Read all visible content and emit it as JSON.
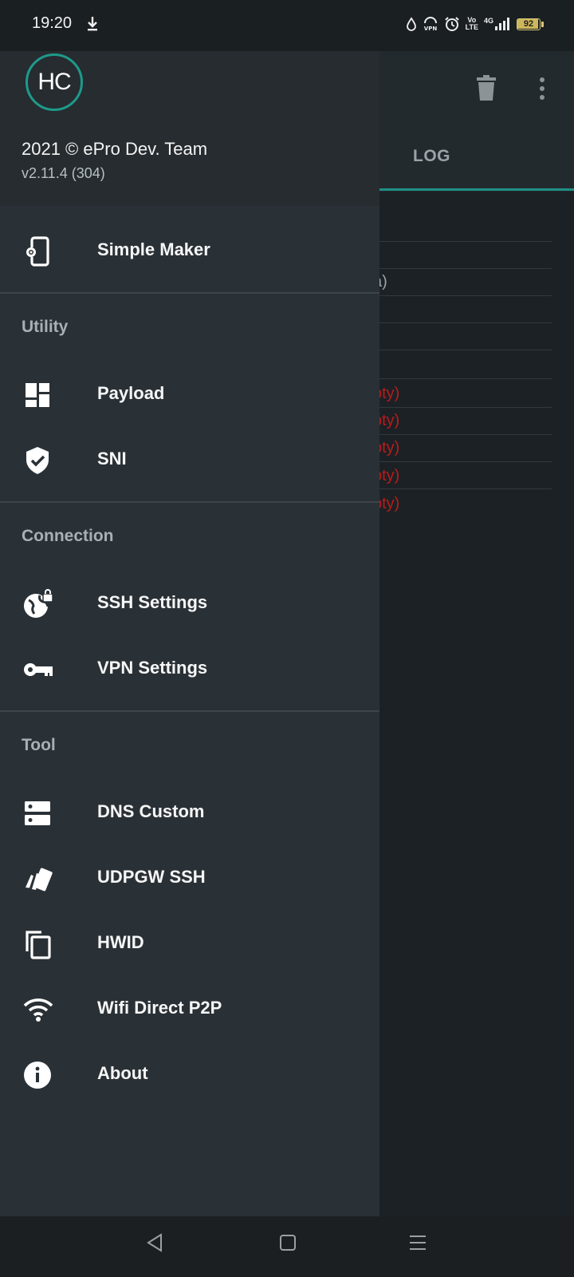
{
  "status_bar": {
    "time": "19:20",
    "battery": "92",
    "lte_label": "LTE",
    "vo_label": "Vo",
    "network": "4G",
    "icons": [
      "download-icon",
      "water-drop-icon",
      "vpn-icon",
      "alarm-icon",
      "volte-icon",
      "signal-icon",
      "battery-icon"
    ]
  },
  "background_app": {
    "tab_log": "LOG",
    "partial_gray": [
      "a)"
    ],
    "partial_red": [
      "pty)",
      "pty)",
      "pty)",
      "pty)",
      "pty)"
    ]
  },
  "drawer": {
    "logo_text": "HC",
    "copyright": "2021 © ePro Dev. Team",
    "version": "v2.11.4 (304)",
    "simple_maker": "Simple Maker",
    "section_utility": "Utility",
    "payload": "Payload",
    "sni": "SNI",
    "section_connection": "Connection",
    "ssh_settings": "SSH Settings",
    "vpn_settings": "VPN Settings",
    "section_tool": "Tool",
    "dns_custom": "DNS Custom",
    "udpgw_ssh": "UDPGW SSH",
    "hwid": "HWID",
    "wifi_direct": "Wifi Direct P2P",
    "about": "About"
  },
  "colors": {
    "accent": "#1e9a8a",
    "drawer_bg": "#2a3136",
    "error_text": "#b71c1c"
  }
}
